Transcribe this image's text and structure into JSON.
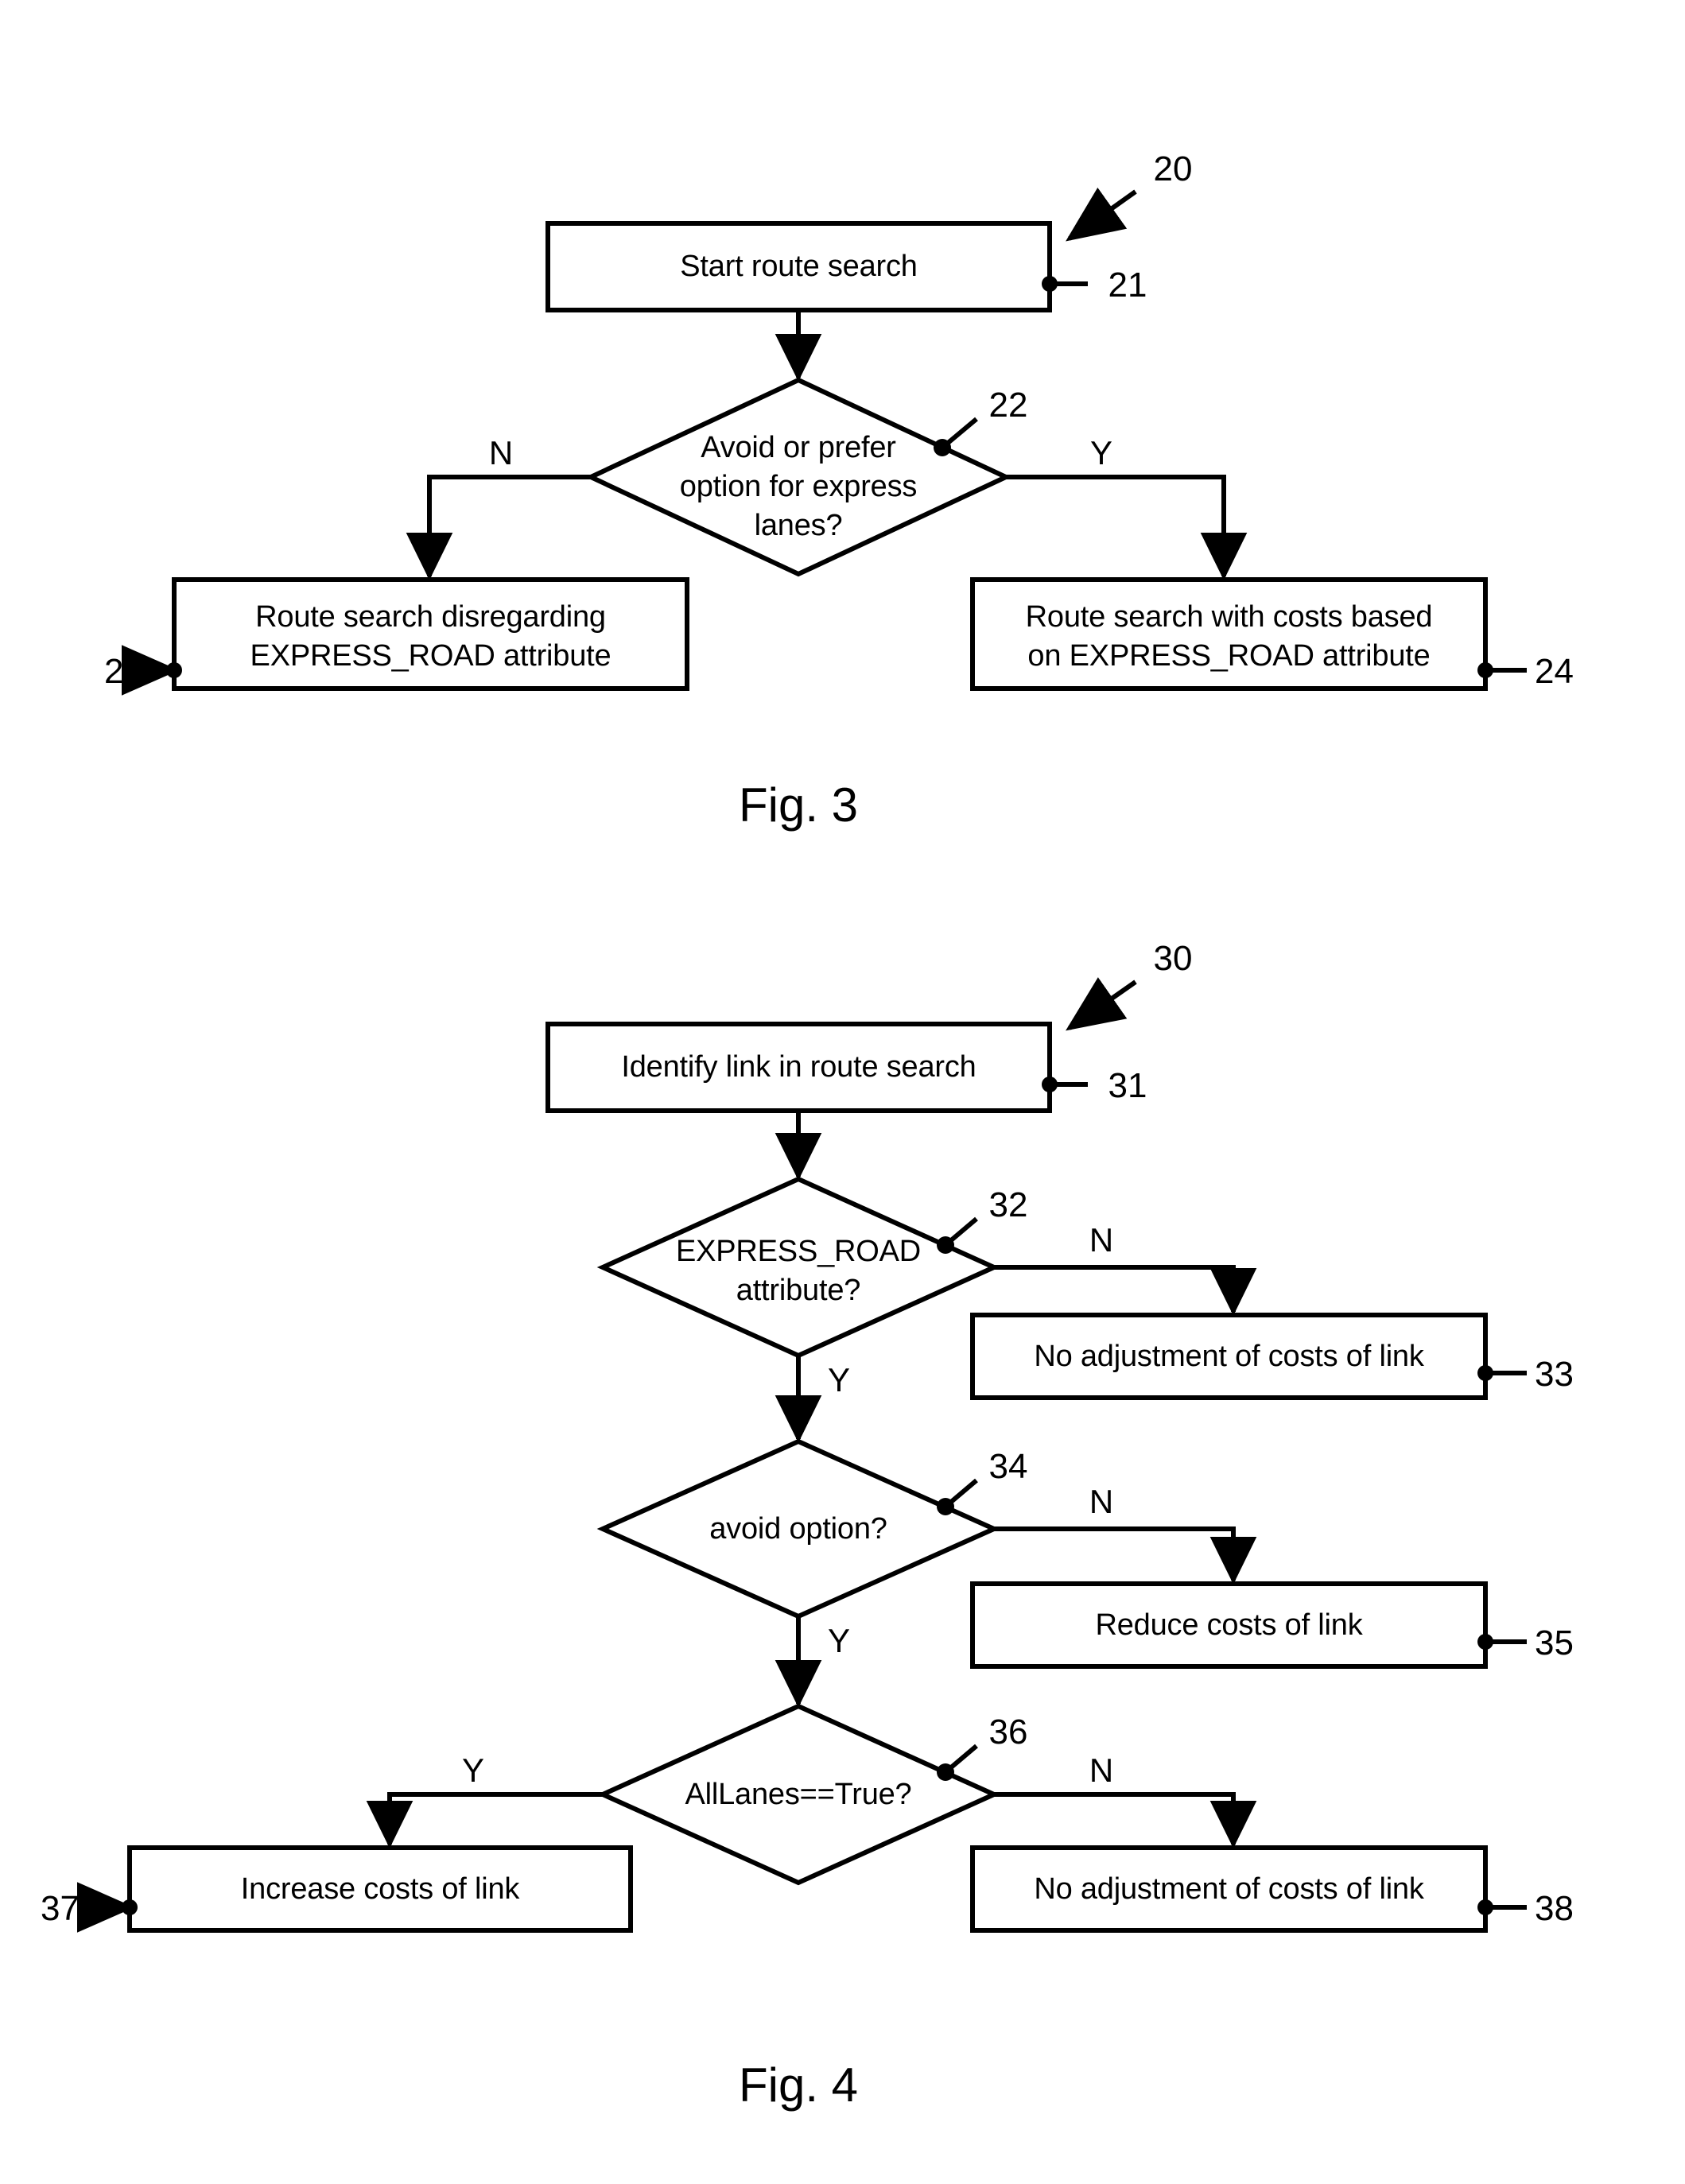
{
  "document": {
    "type": "patent-figure-sheet",
    "figures": [
      {
        "caption": "Fig. 3",
        "reference": "20",
        "nodes": [
          {
            "id": "21",
            "kind": "process",
            "label": "Start route search",
            "ref": "21"
          },
          {
            "id": "22",
            "kind": "decision",
            "label": "Avoid or prefer\noption for express\nlanes?",
            "ref": "22"
          },
          {
            "id": "23",
            "kind": "process",
            "label": "Route search disregarding\nEXPRESS_ROAD attribute",
            "ref": "23"
          },
          {
            "id": "24",
            "kind": "process",
            "label": "Route search with costs based\non EXPRESS_ROAD attribute",
            "ref": "24"
          }
        ],
        "branch_labels": [
          {
            "label": "N",
            "from": "22",
            "to": "23"
          },
          {
            "label": "Y",
            "from": "22",
            "to": "24"
          }
        ]
      },
      {
        "caption": "Fig. 4",
        "reference": "30",
        "nodes": [
          {
            "id": "31",
            "kind": "process",
            "label": "Identify link in route search",
            "ref": "31"
          },
          {
            "id": "32",
            "kind": "decision",
            "label": "EXPRESS_ROAD\nattribute?",
            "ref": "32"
          },
          {
            "id": "33",
            "kind": "process",
            "label": "No adjustment of costs of link",
            "ref": "33"
          },
          {
            "id": "34",
            "kind": "decision",
            "label": "avoid option?",
            "ref": "34"
          },
          {
            "id": "35",
            "kind": "process",
            "label": "Reduce costs of link",
            "ref": "35"
          },
          {
            "id": "36",
            "kind": "decision",
            "label": "AllLanes==True?",
            "ref": "36"
          },
          {
            "id": "37",
            "kind": "process",
            "label": "Increase costs of link",
            "ref": "37"
          },
          {
            "id": "38",
            "kind": "process",
            "label": "No adjustment of costs of link",
            "ref": "38"
          }
        ],
        "branch_labels": [
          {
            "label": "N",
            "from": "32",
            "to": "33"
          },
          {
            "label": "Y",
            "from": "32",
            "to": "34"
          },
          {
            "label": "N",
            "from": "34",
            "to": "35"
          },
          {
            "label": "Y",
            "from": "34",
            "to": "36"
          },
          {
            "label": "Y",
            "from": "36",
            "to": "37"
          },
          {
            "label": "N",
            "from": "36",
            "to": "38"
          }
        ]
      }
    ]
  },
  "fig3": {
    "caption": "Fig. 3",
    "ref_20": "20",
    "box21": {
      "text": "Start route search",
      "ref": "21"
    },
    "diamond22": {
      "line1": "Avoid or prefer",
      "line2": "option for express",
      "line3": "lanes?",
      "ref": "22"
    },
    "box23": {
      "line1": "Route search disregarding",
      "line2": "EXPRESS_ROAD attribute",
      "ref": "23"
    },
    "box24": {
      "line1": "Route search with costs based",
      "line2": "on EXPRESS_ROAD attribute",
      "ref": "24"
    },
    "label_n": "N",
    "label_y": "Y"
  },
  "fig4": {
    "caption": "Fig. 4",
    "ref_30": "30",
    "box31": {
      "text": "Identify link in route search",
      "ref": "31"
    },
    "diamond32": {
      "line1": "EXPRESS_ROAD",
      "line2": "attribute?",
      "ref": "32"
    },
    "box33": {
      "text": "No adjustment of costs of link",
      "ref": "33"
    },
    "diamond34": {
      "text": "avoid option?",
      "ref": "34"
    },
    "box35": {
      "text": "Reduce costs of link",
      "ref": "35"
    },
    "diamond36": {
      "text": "AllLanes==True?",
      "ref": "36"
    },
    "box37": {
      "text": "Increase costs of link",
      "ref": "37"
    },
    "box38": {
      "text": "No adjustment of costs of link",
      "ref": "38"
    },
    "label_n32": "N",
    "label_y32": "Y",
    "label_n34": "N",
    "label_y34": "Y",
    "label_y36": "Y",
    "label_n36": "N"
  },
  "colors": {
    "ink": "#000000",
    "paper": "#ffffff"
  }
}
